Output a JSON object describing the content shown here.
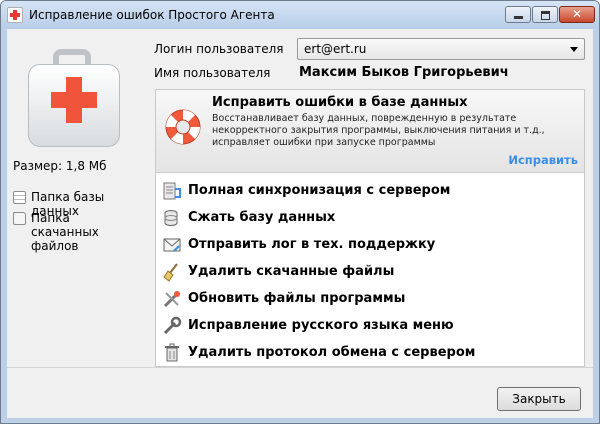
{
  "window": {
    "title": "Исправление ошибок Простого Агента",
    "controls": {
      "minimize": "minimize",
      "maximize": "maximize",
      "close": "✕"
    }
  },
  "left": {
    "size_label": "Размер: 1,8 Мб",
    "folders": [
      {
        "icon": "database-folder-icon",
        "label": "Папка базы данных"
      },
      {
        "icon": "folder-icon",
        "label": "Папка скачанных файлов"
      }
    ]
  },
  "user": {
    "login_label": "Логин пользователя",
    "login_value": "ert@ert.ru",
    "name_label": "Имя пользователя",
    "name_value": "Максим Быков Григорьевич"
  },
  "featured": {
    "title": "Исправить ошибки в базе данных",
    "description": "Восстанавливает базу данных, поврежденную в результате некорректного закрытия программы, выключения питания и т.д., исправляет ошибки при запуске программы",
    "link": "Исправить",
    "link_color": "#3a8ee6",
    "icon": "lifebuoy-icon"
  },
  "actions": [
    {
      "icon": "server-sync-icon",
      "label": "Полная синхронизация с сервером"
    },
    {
      "icon": "compress-database-icon",
      "label": "Сжать базу данных"
    },
    {
      "icon": "send-log-icon",
      "label": "Отправить лог в тех. поддержку"
    },
    {
      "icon": "broom-icon",
      "label": "Удалить скачанные файлы"
    },
    {
      "icon": "tools-icon",
      "label": "Обновить файлы программы"
    },
    {
      "icon": "wrench-icon",
      "label": "Исправление русского языка меню"
    },
    {
      "icon": "trash-icon",
      "label": "Удалить протокол обмена с сервером"
    }
  ],
  "footer": {
    "close_label": "Закрыть"
  },
  "colors": {
    "accent_red": "#f0553b",
    "link_blue": "#3a8ee6",
    "window_frame": "#bcd0e8"
  }
}
